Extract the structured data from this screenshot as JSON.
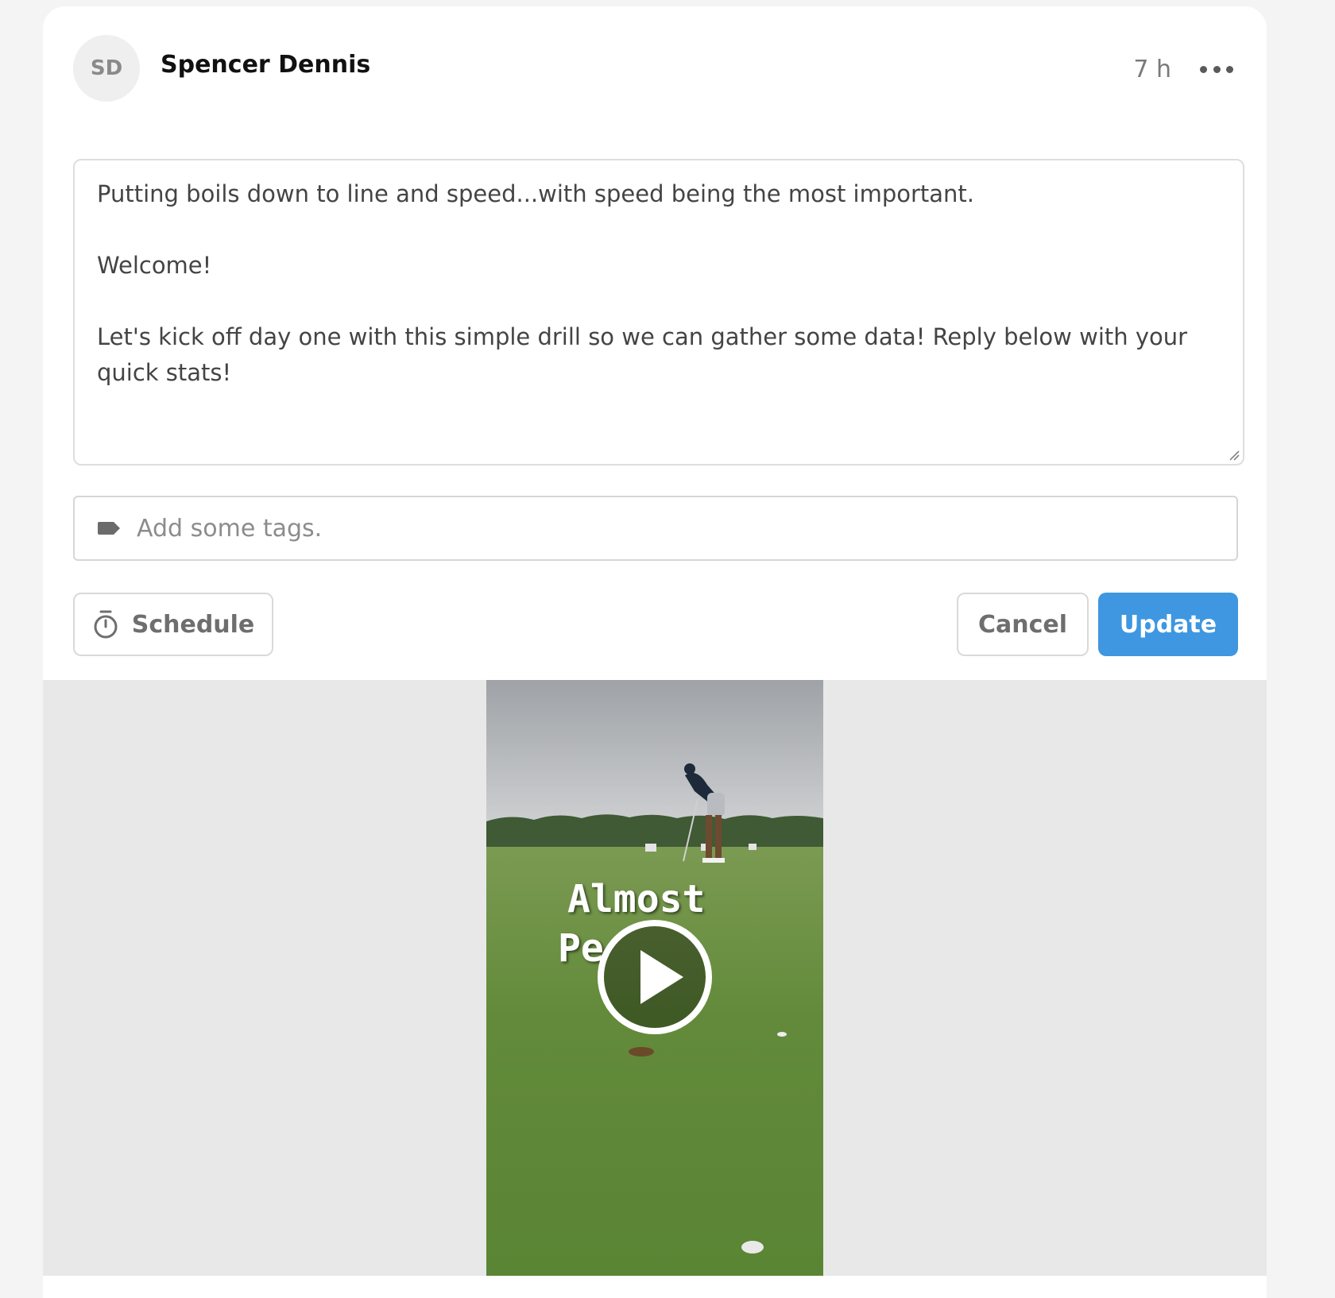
{
  "post": {
    "author_initials": "SD",
    "author_name": "Spencer Dennis",
    "time_ago": "7 h",
    "more_icon": "more-horizontal-icon"
  },
  "editor": {
    "paragraphs": [
      "Putting boils down to line and speed...with speed being the most important.",
      "Welcome!",
      "Let's kick off day one with this simple drill so we can gather some data! Reply below with your quick stats!"
    ]
  },
  "tags": {
    "placeholder": "Add some tags.",
    "icon": "tag-icon"
  },
  "actions": {
    "schedule_label": "Schedule",
    "schedule_icon": "stopwatch-icon",
    "cancel_label": "Cancel",
    "update_label": "Update"
  },
  "media": {
    "overlay_line1": "Almost",
    "overlay_line2": "Pe",
    "play_icon": "play-icon"
  },
  "colors": {
    "accent": "#3e97e0",
    "grass": "#5f8a3a",
    "sky": "#b9bbbe"
  }
}
